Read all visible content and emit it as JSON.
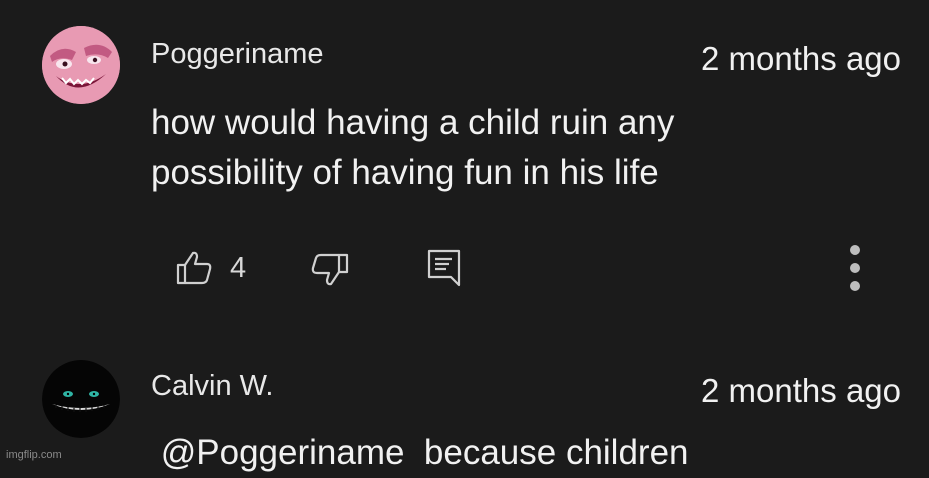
{
  "comments": [
    {
      "username": "Poggeriname",
      "timestamp": "2 months ago",
      "text": "how would having a child ruin any\npossibility of having fun in his life",
      "like_count": "4",
      "avatar_icon": "pink-cartoon-face-avatar",
      "actions": {
        "like_icon": "thumbs-up-icon",
        "dislike_icon": "thumbs-down-icon",
        "reply_icon": "reply-comment-icon",
        "more_icon": "more-vertical-icon"
      }
    },
    {
      "username": "Calvin W.",
      "timestamp": "2 months ago",
      "text": " @Poggeriname  because children",
      "avatar_icon": "dark-grin-eyes-avatar"
    }
  ],
  "watermark": "imgflip.com",
  "colors": {
    "background": "#1b1b1b",
    "text": "#f1f1f1",
    "icon": "#d0d0d0"
  }
}
